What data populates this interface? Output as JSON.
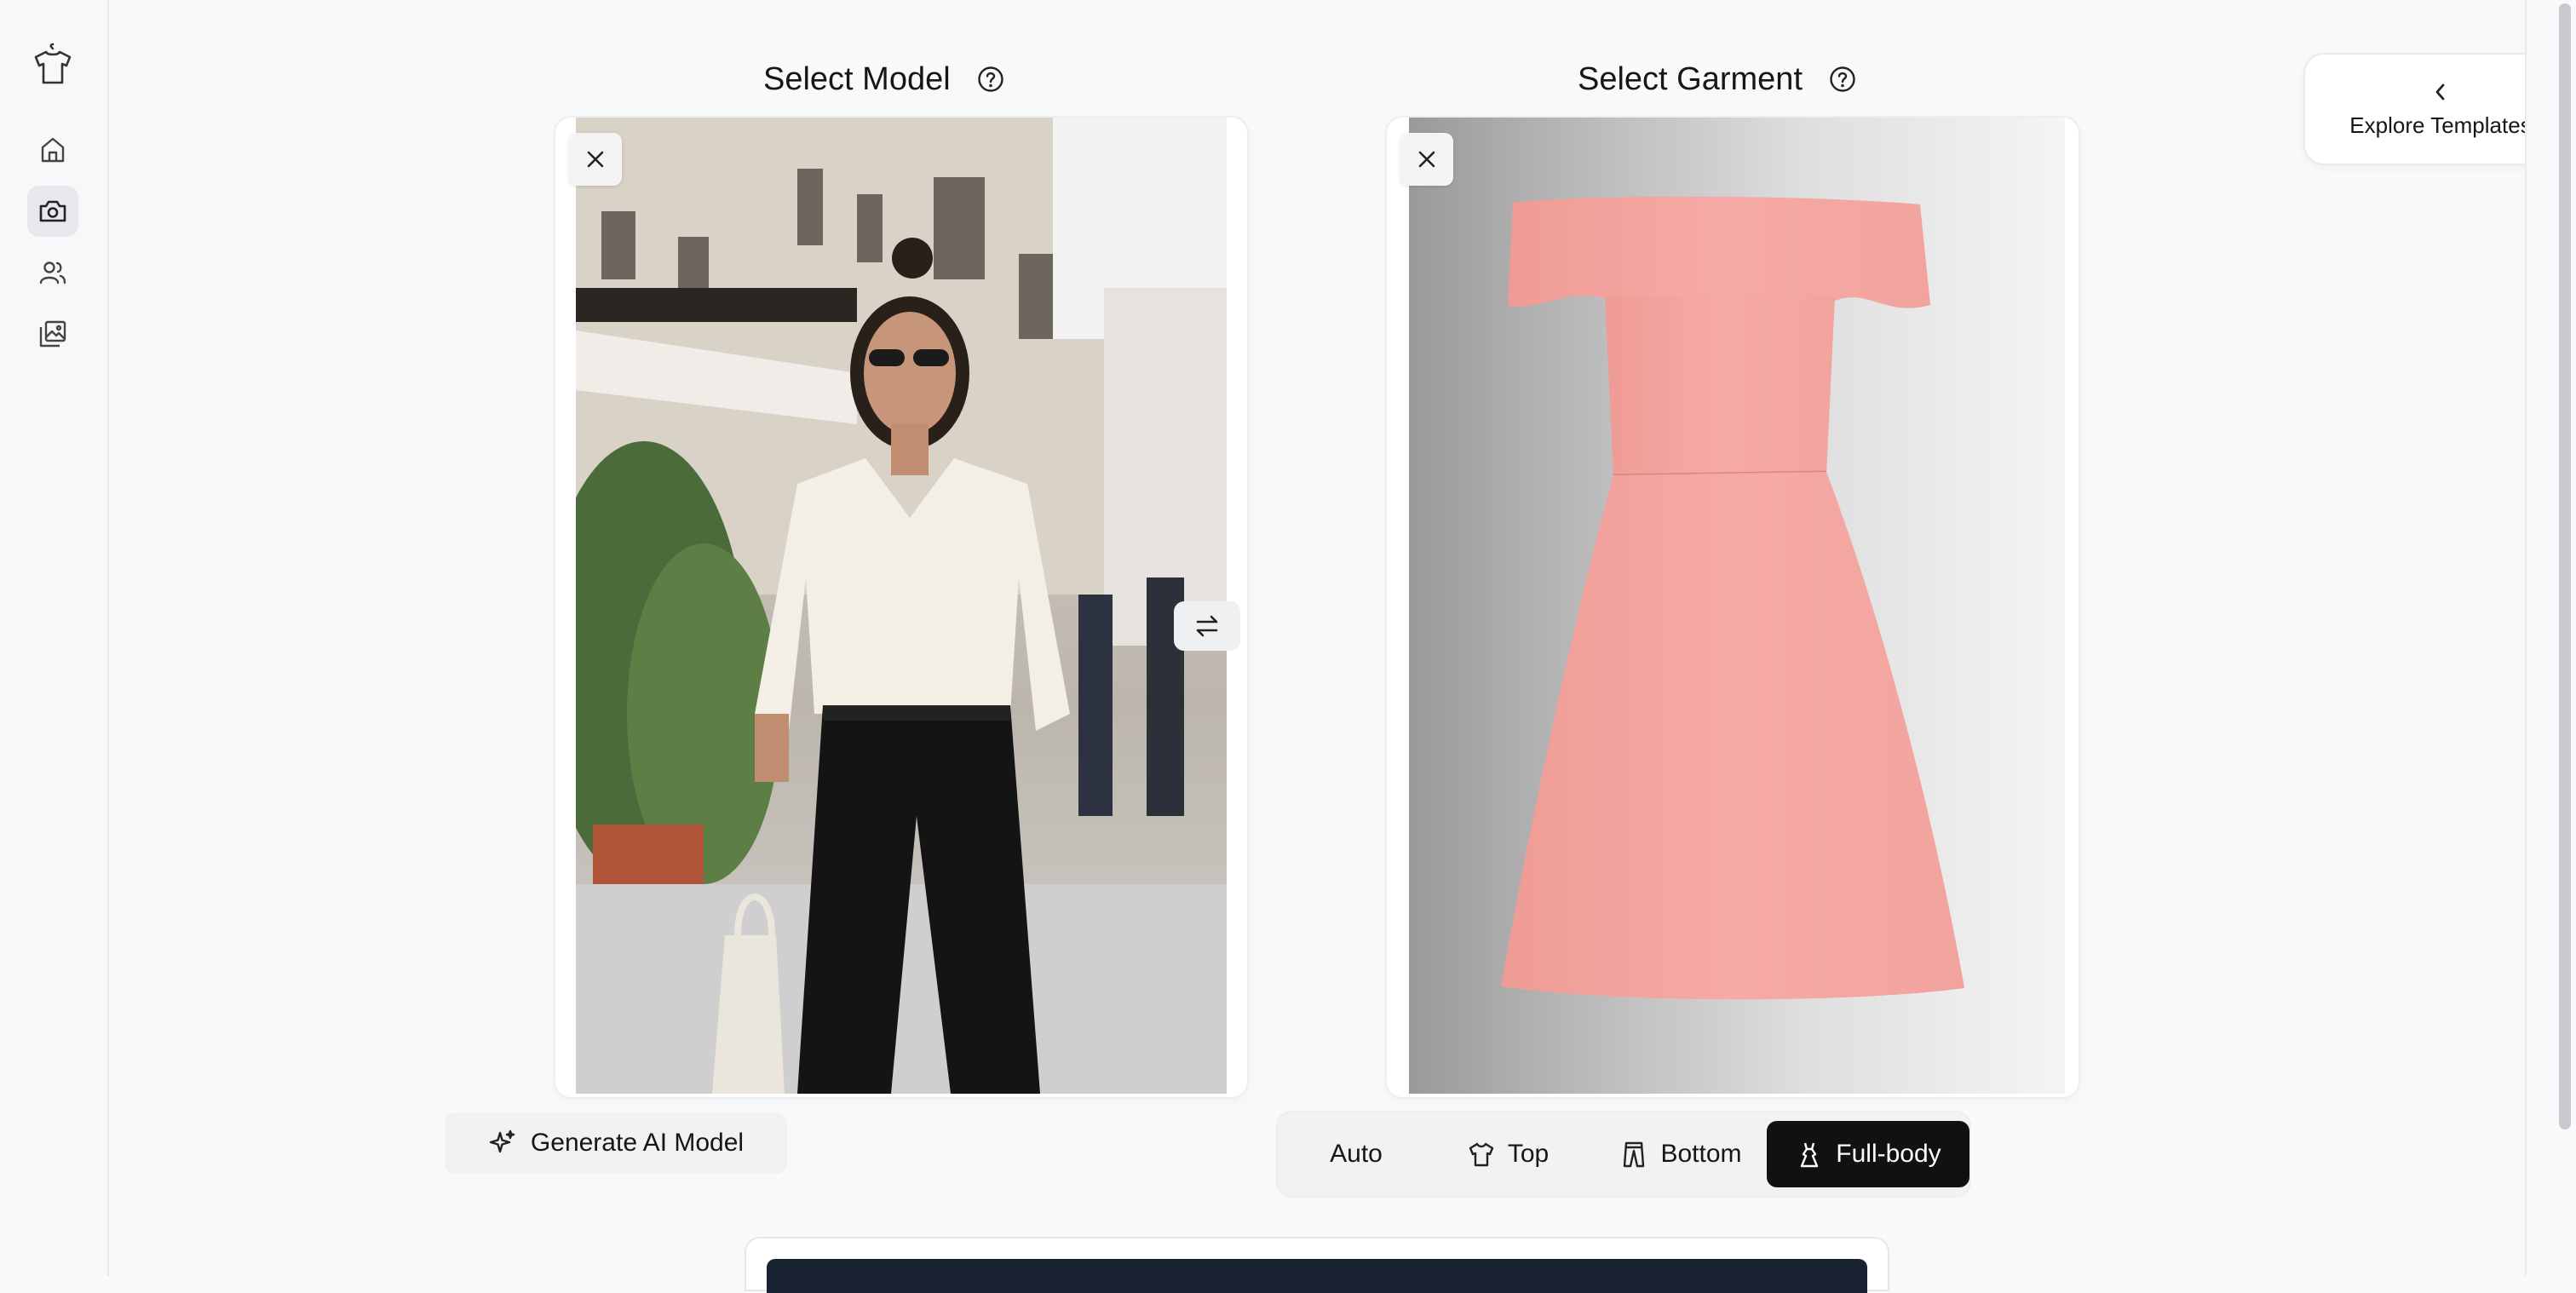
{
  "sidebar": {
    "logo": "tshirt-logo-icon",
    "items": [
      {
        "name": "home",
        "icon": "home-icon",
        "active": false
      },
      {
        "name": "camera",
        "icon": "camera-icon",
        "active": true
      },
      {
        "name": "users",
        "icon": "users-icon",
        "active": false
      },
      {
        "name": "gallery",
        "icon": "gallery-icon",
        "active": false
      }
    ]
  },
  "model": {
    "title": "Select Model",
    "help_icon": "help-circle-icon",
    "close_icon": "close-icon",
    "generate_label": "Generate AI Model",
    "generate_icon": "sparkle-icon"
  },
  "garment": {
    "title": "Select Garment",
    "help_icon": "help-circle-icon",
    "close_icon": "close-icon",
    "types": [
      {
        "label": "Auto",
        "icon": null,
        "selected": false
      },
      {
        "label": "Top",
        "icon": "shirt-icon",
        "selected": false
      },
      {
        "label": "Bottom",
        "icon": "pants-icon",
        "selected": false
      },
      {
        "label": "Full-body",
        "icon": "dress-icon",
        "selected": true
      }
    ]
  },
  "swap_icon": "swap-arrows-icon",
  "explore": {
    "label": "Explore Templates",
    "icon": "chevron-left-icon"
  },
  "colors": {
    "accent": "#111111",
    "dress": "#f4a5a0",
    "panel": "#1a2332"
  }
}
